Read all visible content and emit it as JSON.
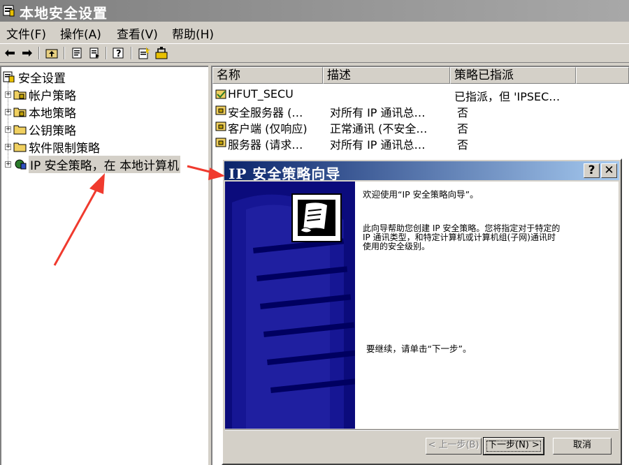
{
  "window": {
    "title": "本地安全设置"
  },
  "menu": [
    {
      "label": "文件(F)"
    },
    {
      "label": "操作(A)"
    },
    {
      "label": "查看(V)"
    },
    {
      "label": "帮助(H)"
    }
  ],
  "toolbar": {
    "buttons": [
      "back-icon",
      "forward-icon",
      "up-folder-icon",
      "properties-icon",
      "export-list-icon",
      "help-icon",
      "new-policy-icon",
      "manage-filters-icon"
    ]
  },
  "tree": {
    "root": "安全设置",
    "items": [
      {
        "label": "帐户策略",
        "icon": "folder-icon"
      },
      {
        "label": "本地策略",
        "icon": "folder-icon"
      },
      {
        "label": "公钥策略",
        "icon": "folder-icon"
      },
      {
        "label": "软件限制策略",
        "icon": "folder-icon"
      },
      {
        "label": "IP 安全策略，在 本地计算机",
        "icon": "ip-security-icon"
      }
    ]
  },
  "list": {
    "columns": [
      "名称",
      "描述",
      "策略已指派"
    ],
    "rows": [
      {
        "name": "HFUT_SECU",
        "desc": "",
        "assigned": "已指派，但 'IPSEC…"
      },
      {
        "name": "安全服务器 (…",
        "desc": "对所有 IP 通讯总…",
        "assigned": "否"
      },
      {
        "name": "客户端 (仅响应)",
        "desc": "正常通讯 (不安全…",
        "assigned": "否"
      },
      {
        "name": "服务器 (请求…",
        "desc": "对所有 IP 通讯总…",
        "assigned": "否"
      }
    ]
  },
  "dialog": {
    "title": "IP 安全策略向导",
    "help_label": "?",
    "close_label": "✕",
    "welcome": "欢迎使用“IP 安全策略向导”。",
    "desc_line1": "此向导帮助您创建 IP 安全策略。您将指定对于特定的",
    "desc_line2": "IP 通讯类型，和特定计算机或计算机组(子网)通讯时",
    "desc_line3": "使用的安全级别。",
    "continue": "要继续，请单击“下一步”。",
    "back_label": "< 上一步(B)",
    "next_label": "下一步(N) >",
    "cancel_label": "取消"
  },
  "colors": {
    "title_active": "#0a246a",
    "annotation_arrow": "#f03a2e"
  }
}
